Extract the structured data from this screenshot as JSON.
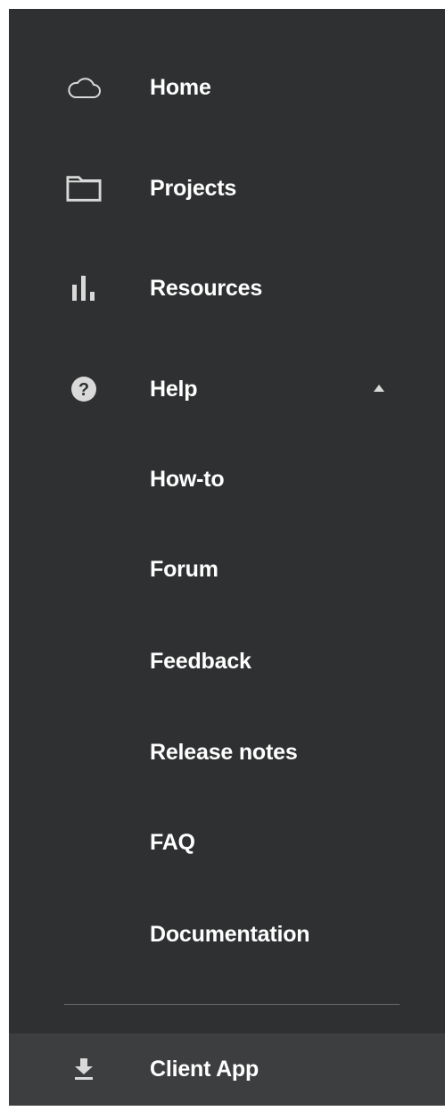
{
  "colors": {
    "sidebar_bg": "#2f3031",
    "footer_bg": "#3d3e3f",
    "text": "#ffffff",
    "icon": "#d9d9d9",
    "divider": "#6a6b6c"
  },
  "nav": {
    "items": [
      {
        "label": "Home",
        "icon": "cloud-icon"
      },
      {
        "label": "Projects",
        "icon": "folder-icon"
      },
      {
        "label": "Resources",
        "icon": "bar-chart-icon"
      },
      {
        "label": "Help",
        "icon": "help-icon",
        "expanded": true,
        "caret_icon": "caret-up-icon"
      }
    ],
    "help_subitems": [
      {
        "label": "How-to"
      },
      {
        "label": "Forum"
      },
      {
        "label": "Feedback"
      },
      {
        "label": "Release notes"
      },
      {
        "label": "FAQ"
      },
      {
        "label": "Documentation"
      }
    ]
  },
  "footer": {
    "label": "Client App",
    "icon": "download-icon"
  }
}
